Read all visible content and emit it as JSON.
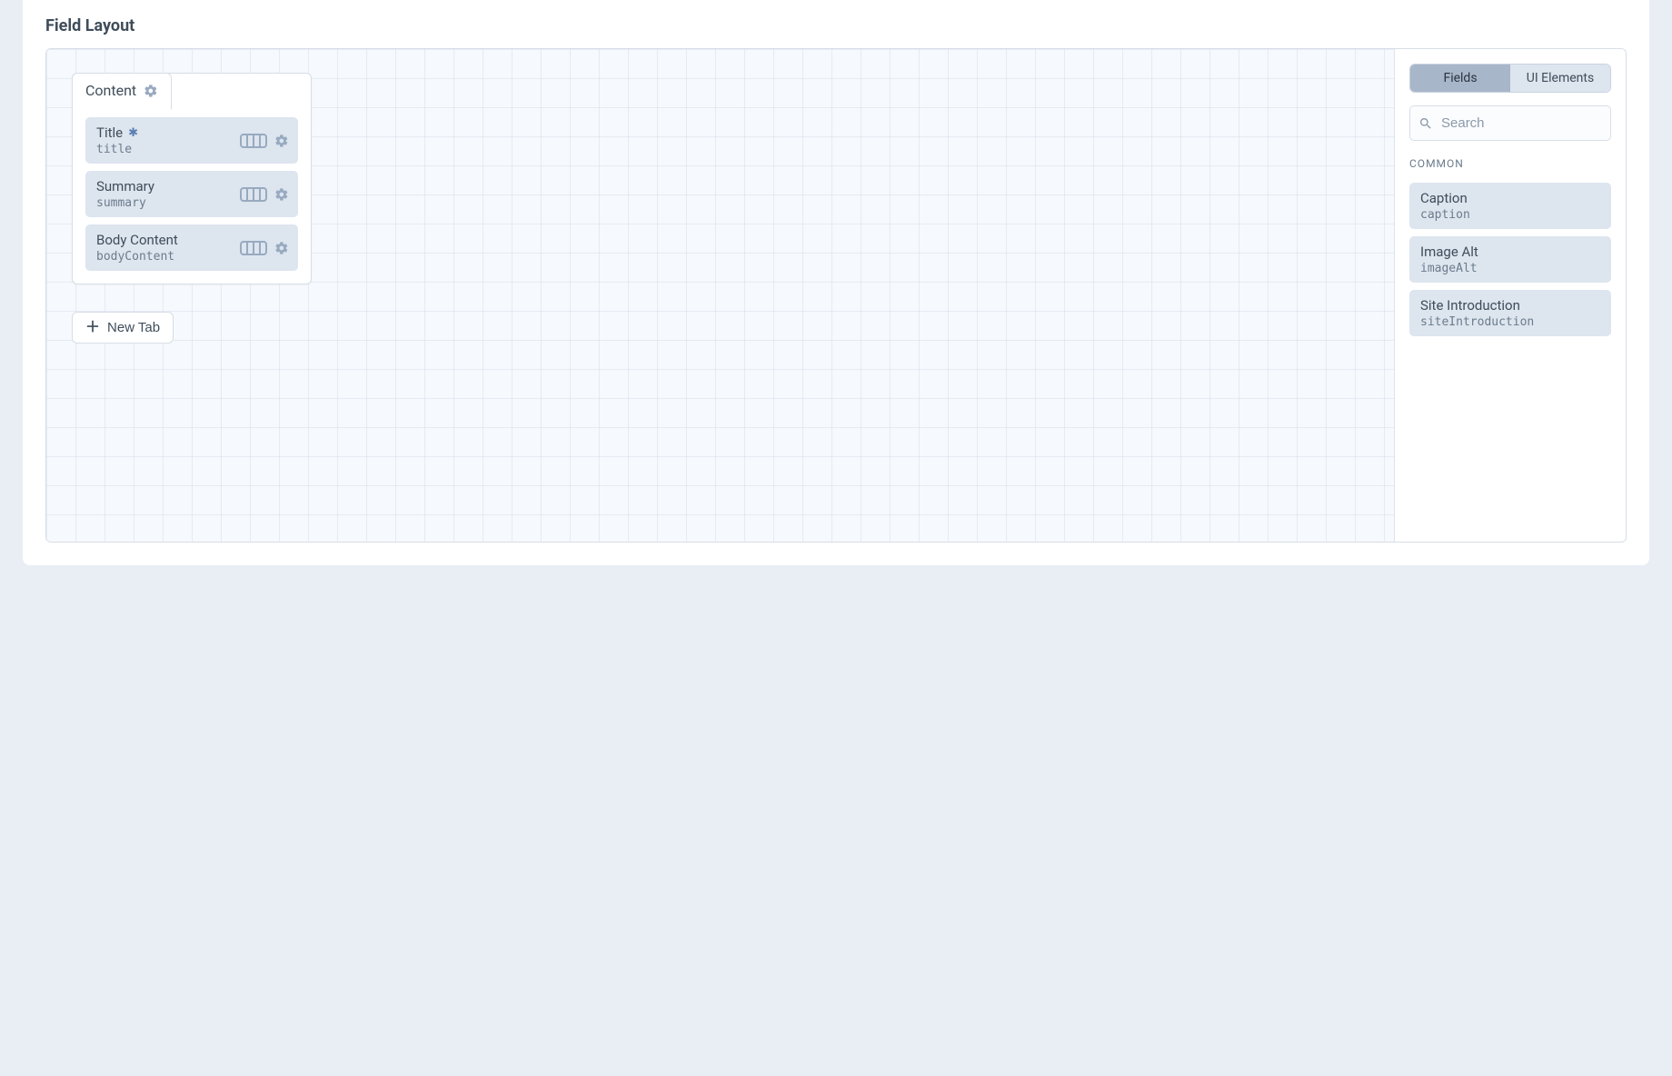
{
  "section_title": "Field Layout",
  "tab": {
    "name": "Content",
    "fields": [
      {
        "label": "Title",
        "handle": "title",
        "required": true
      },
      {
        "label": "Summary",
        "handle": "summary",
        "required": false
      },
      {
        "label": "Body Content",
        "handle": "bodyContent",
        "required": false
      }
    ]
  },
  "new_tab_label": "New Tab",
  "sidebar": {
    "tabs": {
      "fields": "Fields",
      "ui_elements": "UI Elements",
      "active": "fields"
    },
    "search_placeholder": "Search",
    "group_label": "COMMON",
    "available": [
      {
        "label": "Caption",
        "handle": "caption"
      },
      {
        "label": "Image Alt",
        "handle": "imageAlt"
      },
      {
        "label": "Site Introduction",
        "handle": "siteIntroduction"
      }
    ]
  }
}
